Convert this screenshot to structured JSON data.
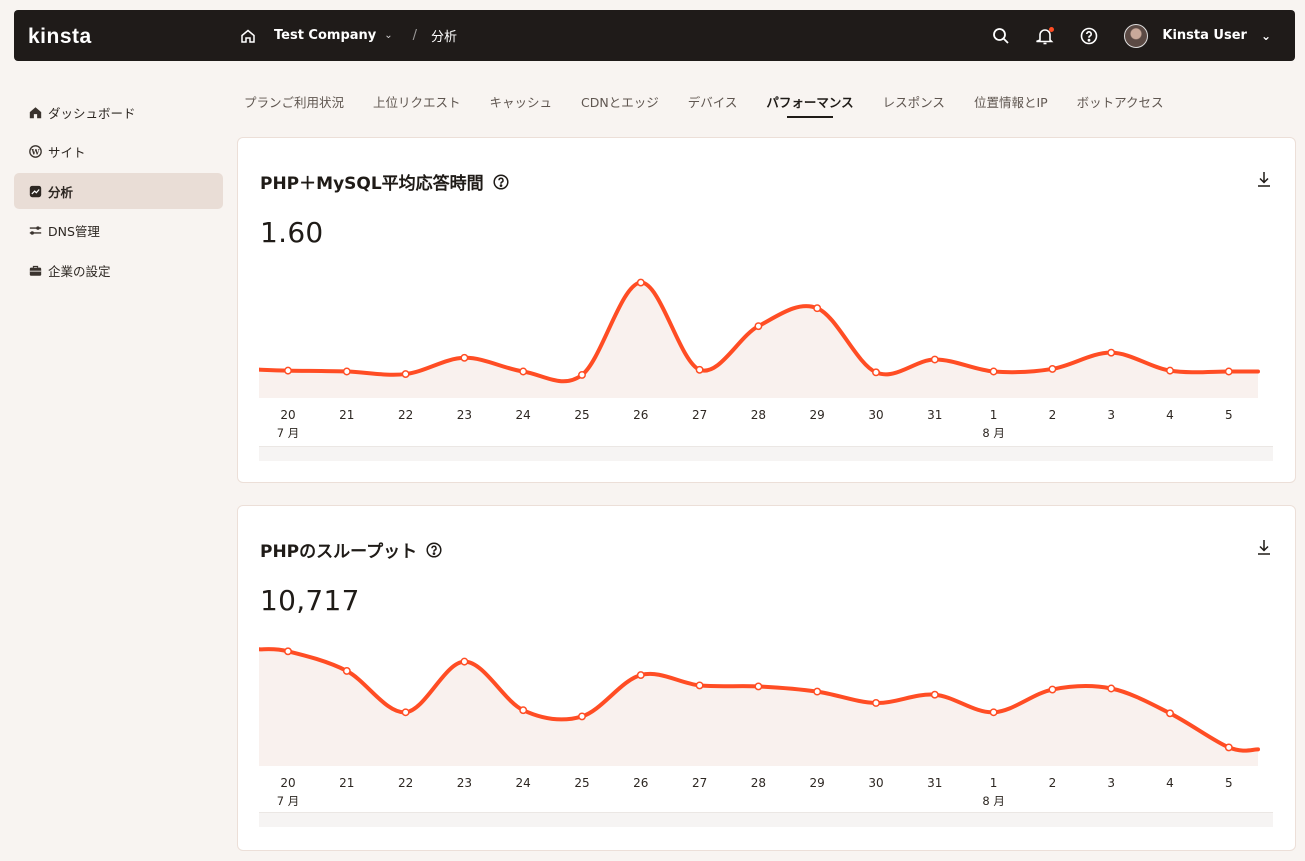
{
  "brand": "kinsta",
  "header": {
    "company": "Test Company",
    "section": "分析",
    "user_name": "Kinsta User",
    "accent": "#ff4d24"
  },
  "sidebar": {
    "items": [
      {
        "label": "ダッシュボード",
        "icon": "home-icon"
      },
      {
        "label": "サイト",
        "icon": "wordpress-icon"
      },
      {
        "label": "分析",
        "icon": "analytics-icon",
        "active": true
      },
      {
        "label": "DNS管理",
        "icon": "dns-icon"
      },
      {
        "label": "企業の設定",
        "icon": "briefcase-icon"
      }
    ]
  },
  "tabs": [
    {
      "label": "プランご利用状況"
    },
    {
      "label": "上位リクエスト"
    },
    {
      "label": "キャッシュ"
    },
    {
      "label": "CDNとエッジ"
    },
    {
      "label": "デバイス"
    },
    {
      "label": "パフォーマンス",
      "active": true
    },
    {
      "label": "レスポンス"
    },
    {
      "label": "位置情報とIP"
    },
    {
      "label": "ボットアクセス"
    }
  ],
  "cards": [
    {
      "title": "PHP＋MySQL平均応答時間",
      "value": "1.60"
    },
    {
      "title": "PHPのスループット",
      "value": "10,717"
    }
  ],
  "chart_data": [
    {
      "type": "line",
      "x": [
        "20",
        "21",
        "22",
        "23",
        "24",
        "25",
        "26",
        "27",
        "28",
        "29",
        "30",
        "31",
        "1",
        "2",
        "3",
        "4",
        "5"
      ],
      "month_labels": [
        {
          "at": "20",
          "label": "7 月"
        },
        {
          "at": "1",
          "label": "8 月"
        }
      ],
      "values": [
        0.32,
        0.31,
        0.28,
        0.47,
        0.31,
        0.27,
        1.35,
        0.33,
        0.84,
        1.05,
        0.3,
        0.45,
        0.31,
        0.34,
        0.53,
        0.32,
        0.31
      ],
      "ylim": [
        0,
        1.45
      ]
    },
    {
      "type": "line",
      "x": [
        "20",
        "21",
        "22",
        "23",
        "24",
        "25",
        "26",
        "27",
        "28",
        "29",
        "30",
        "31",
        "1",
        "2",
        "3",
        "4",
        "5"
      ],
      "month_labels": [
        {
          "at": "20",
          "label": "7 月"
        },
        {
          "at": "1",
          "label": "8 月"
        }
      ],
      "values": [
        1110,
        920,
        520,
        1010,
        540,
        480,
        880,
        780,
        770,
        720,
        610,
        690,
        520,
        740,
        750,
        510,
        180
      ],
      "ylim": [
        0,
        1200
      ]
    }
  ]
}
